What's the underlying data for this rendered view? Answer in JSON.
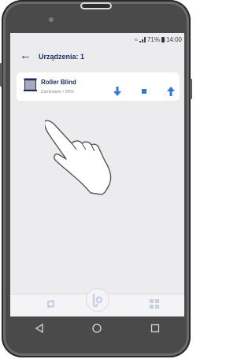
{
  "status_bar": {
    "battery": "71%",
    "time": "14:00"
  },
  "header": {
    "title": "Urządzenia: 1"
  },
  "device": {
    "name": "Roller Blind",
    "status": "Zamknięte • 95%"
  },
  "colors": {
    "accent": "#2e7bd6",
    "title_text": "#1f2c5c",
    "nav_inactive": "#c6cfe4"
  },
  "icons": {
    "back": "arrow-left-icon",
    "device": "roller-blind-icon",
    "down": "arrow-down-icon",
    "stop": "stop-icon",
    "up": "arrow-up-icon"
  }
}
